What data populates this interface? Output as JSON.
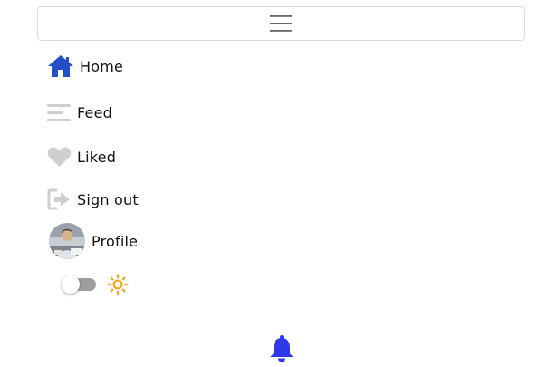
{
  "topbar": {
    "menu_icon": "hamburger-icon"
  },
  "nav": {
    "items": [
      {
        "label": "Home",
        "icon": "home-icon",
        "color": "#2150c8"
      },
      {
        "label": "Feed",
        "icon": "feed-lines-icon",
        "color": "#cfcfcf"
      },
      {
        "label": "Liked",
        "icon": "heart-icon",
        "color": "#cfcfcf"
      },
      {
        "label": "Sign out",
        "icon": "sign-out-icon",
        "color": "#cfcfcf"
      },
      {
        "label": "Profile",
        "icon": "avatar"
      }
    ]
  },
  "theme": {
    "toggle_state": "off",
    "toggle_color": "#9e9e9e",
    "sun_icon": "sun-icon",
    "sun_color": "#f4a623"
  },
  "notifications": {
    "icon": "bell-icon",
    "color": "#2f39ea"
  }
}
